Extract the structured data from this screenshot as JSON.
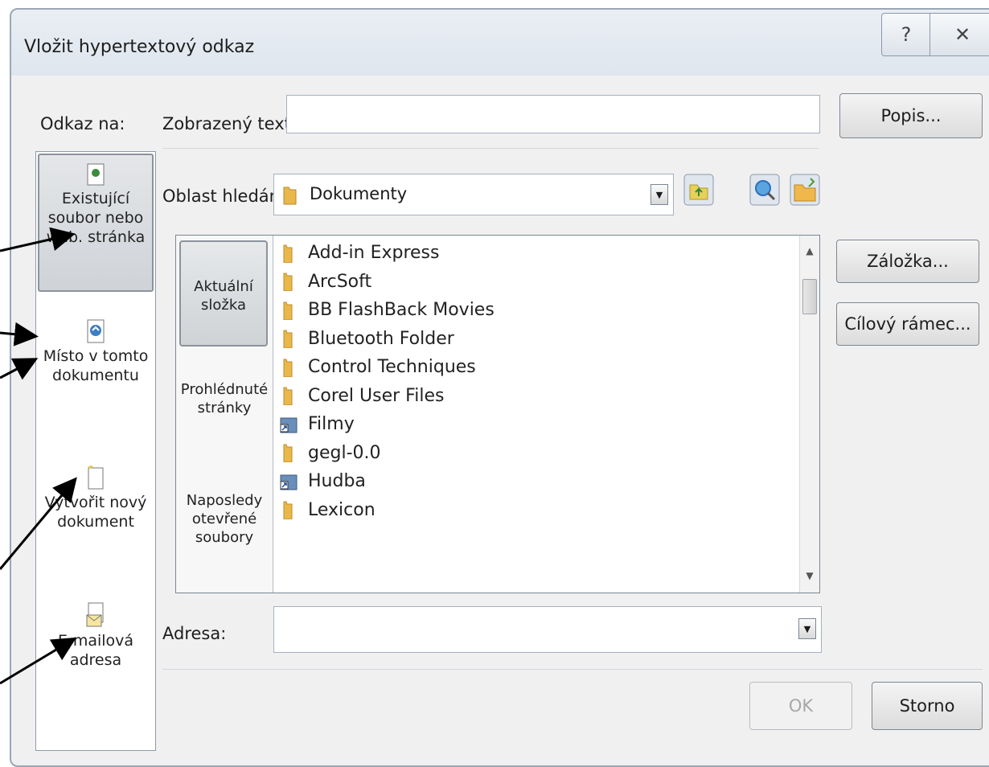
{
  "dialog": {
    "title": "Vložit hypertextový odkaz",
    "help_glyph": "?",
    "close_glyph": "✕"
  },
  "link_to": {
    "label": "Odkaz na:",
    "items": [
      {
        "label": "Existující soubor nebo web. stránka",
        "icon": "file-web-icon"
      },
      {
        "label": "Místo v tomto dokumentu",
        "icon": "document-place-icon"
      },
      {
        "label": "Vytvořit nový dokument",
        "icon": "new-document-icon"
      },
      {
        "label": "E-mailová adresa",
        "icon": "email-icon"
      }
    ]
  },
  "display_text": {
    "label": "Zobrazený text:",
    "value": ""
  },
  "popis_button": "Popis...",
  "look_in": {
    "label": "Oblast hledání:",
    "value": "Dokumenty"
  },
  "places": [
    "Aktuální složka",
    "Prohlédnuté stránky",
    "Naposledy otevřené soubory"
  ],
  "files": [
    {
      "name": "Add-in Express",
      "type": "folder"
    },
    {
      "name": "ArcSoft",
      "type": "folder"
    },
    {
      "name": "BB FlashBack Movies",
      "type": "folder"
    },
    {
      "name": "Bluetooth Folder",
      "type": "folder"
    },
    {
      "name": "Control Techniques",
      "type": "folder"
    },
    {
      "name": "Corel User Files",
      "type": "folder"
    },
    {
      "name": "Filmy",
      "type": "shortcut"
    },
    {
      "name": "gegl-0.0",
      "type": "folder"
    },
    {
      "name": "Hudba",
      "type": "shortcut"
    },
    {
      "name": "Lexicon",
      "type": "folder"
    }
  ],
  "bookmark_button": "Záložka...",
  "target_frame_button": "Cílový rámec...",
  "address": {
    "label": "Adresa:",
    "value": ""
  },
  "ok_button": "OK",
  "cancel_button": "Storno",
  "colors": {
    "folder": "#e8b84a",
    "accent": "#2b6fba"
  }
}
